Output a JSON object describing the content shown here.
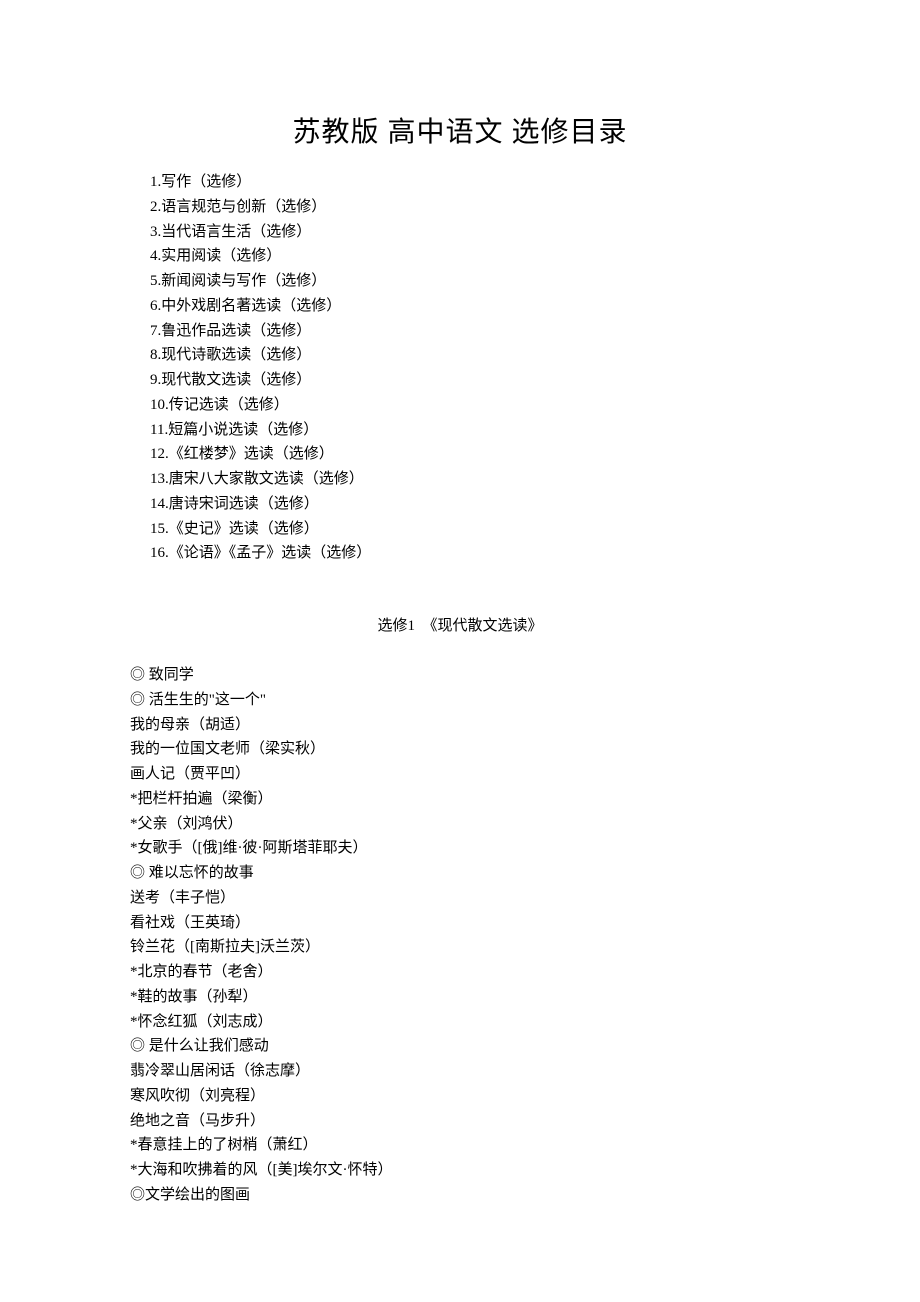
{
  "title": "苏教版 高中语文 选修目录",
  "toc": [
    "1.写作（选修）",
    "2.语言规范与创新（选修）",
    "3.当代语言生活（选修）",
    "4.实用阅读（选修）",
    "5.新闻阅读与写作（选修）",
    "6.中外戏剧名著选读（选修）",
    "7.鲁迅作品选读（选修）",
    "8.现代诗歌选读（选修）",
    "9.现代散文选读（选修）",
    "10.传记选读（选修）",
    "11.短篇小说选读（选修）",
    "12.《红楼梦》选读（选修）",
    "13.唐宋八大家散文选读（选修）",
    "14.唐诗宋词选读（选修）",
    "15.《史记》选读（选修）",
    "16.《论语》《孟子》选读（选修）"
  ],
  "section": {
    "header": "选修1　《现代散文选读》",
    "items": [
      "◎ 致同学",
      "◎ 活生生的\"这一个\"",
      "我的母亲（胡适）",
      "我的一位国文老师（梁实秋）",
      "画人记（贾平凹）",
      "*把栏杆拍遍（梁衡）",
      "*父亲（刘鸿伏）",
      "*女歌手（[俄]维·彼·阿斯塔菲耶夫）",
      "◎ 难以忘怀的故事",
      "送考（丰子恺）",
      "看社戏（王英琦）",
      "铃兰花（[南斯拉夫]沃兰茨）",
      "*北京的春节（老舍）",
      "*鞋的故事（孙犁）",
      "*怀念红狐（刘志成）",
      "◎ 是什么让我们感动",
      "翡冷翠山居闲话（徐志摩）",
      "寒风吹彻（刘亮程）",
      "绝地之音（马步升）",
      "*春意挂上的了树梢（萧红）",
      "*大海和吹拂着的风（[美]埃尔文·怀特）",
      "◎文学绘出的图画"
    ]
  }
}
